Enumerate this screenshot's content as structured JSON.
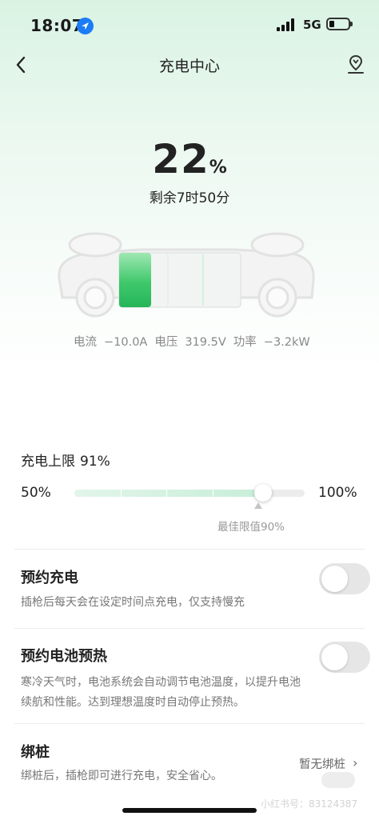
{
  "status_bar": {
    "time": "18:07",
    "network": "5G"
  },
  "header": {
    "title": "充电中心"
  },
  "battery": {
    "percent": "22",
    "percent_unit": "%",
    "remaining": "剩余7时50分",
    "level_fraction": 0.22
  },
  "metrics": [
    {
      "label": "电流",
      "value": "−10.0A"
    },
    {
      "label": "电压",
      "value": "319.5V"
    },
    {
      "label": "功率",
      "value": "−3.2kW"
    }
  ],
  "charge_limit": {
    "label": "充电上限",
    "value": "91%",
    "min_label": "50%",
    "max_label": "100%",
    "min": 50,
    "max": 100,
    "current": 91,
    "best": 90,
    "best_label": "最佳限值90%"
  },
  "scheduled_charge": {
    "title": "预约充电",
    "desc": "插枪后每天会在设定时间点充电，仅支持慢充",
    "enabled": false
  },
  "battery_preheat": {
    "title": "预约电池预热",
    "desc": "寒冷天气时，电池系统会自动调节电池温度，以提升电池续航和性能。达到理想温度时自动停止预热。",
    "enabled": false
  },
  "bind_pile": {
    "title": "绑桩",
    "desc": "绑桩后，插枪即可进行充电，安全省心。",
    "status": "暂无绑桩",
    "arrow": "›"
  },
  "watermark": {
    "text": "小红书号：83124387"
  },
  "colors": {
    "accent": "#2ec15d",
    "track": "#ececec",
    "fill": "#c7eed8"
  }
}
